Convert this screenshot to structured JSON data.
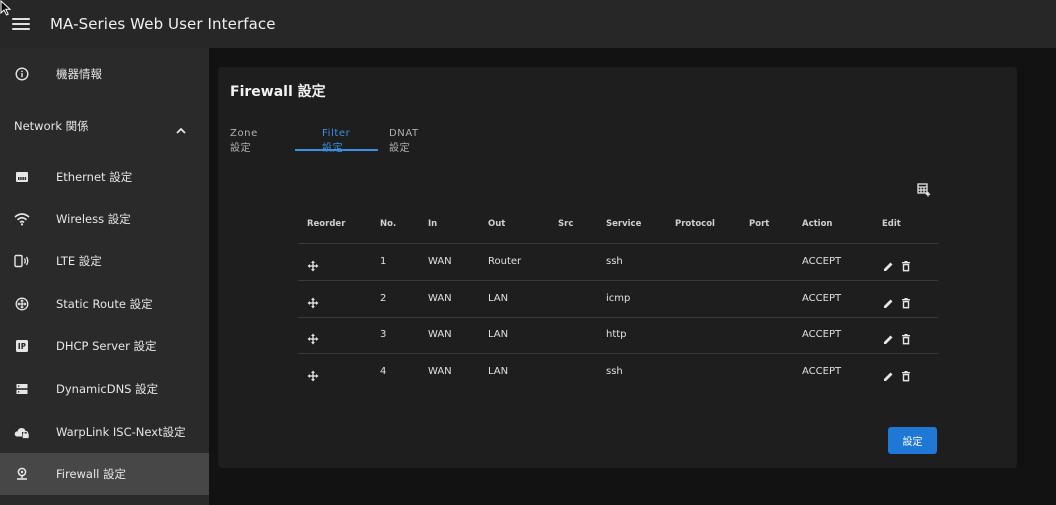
{
  "app": {
    "title": "MA-Series Web User Interface"
  },
  "sidebar": {
    "items": [
      {
        "label": "機器情報",
        "icon": "info-icon"
      },
      {
        "label": "Ethernet 設定",
        "icon": "ethernet-icon"
      },
      {
        "label": "Wireless 設定",
        "icon": "wifi-icon"
      },
      {
        "label": "LTE 設定",
        "icon": "phone-signal-icon"
      },
      {
        "label": "Static Route 設定",
        "icon": "route-icon"
      },
      {
        "label": "DHCP Server 設定",
        "icon": "ip-icon"
      },
      {
        "label": "DynamicDNS 設定",
        "icon": "dns-icon"
      },
      {
        "label": "WarpLink ISC-Next設定",
        "icon": "cloud-lock-icon"
      },
      {
        "label": "Firewall 設定",
        "icon": "firewall-icon"
      }
    ],
    "group_label": "Network 関係",
    "active_item": "Firewall 設定"
  },
  "card": {
    "title": "Firewall 設定",
    "tabs": [
      {
        "label": "Zone 設定"
      },
      {
        "label": "Filter 設定"
      },
      {
        "label": "DNAT 設定"
      }
    ],
    "active_tab": "Filter 設定"
  },
  "table": {
    "headers": [
      "Reorder",
      "No.",
      "In",
      "Out",
      "Src",
      "Service",
      "Protocol",
      "Port",
      "Action",
      "Edit"
    ],
    "rows": [
      {
        "no": "1",
        "in": "WAN",
        "out": "Router",
        "src": "",
        "service": "ssh",
        "protocol": "",
        "port": "",
        "action": "ACCEPT"
      },
      {
        "no": "2",
        "in": "WAN",
        "out": "LAN",
        "src": "",
        "service": "icmp",
        "protocol": "",
        "port": "",
        "action": "ACCEPT"
      },
      {
        "no": "3",
        "in": "WAN",
        "out": "LAN",
        "src": "",
        "service": "http",
        "protocol": "",
        "port": "",
        "action": "ACCEPT"
      },
      {
        "no": "4",
        "in": "WAN",
        "out": "LAN",
        "src": "",
        "service": "ssh",
        "protocol": "",
        "port": "",
        "action": "ACCEPT"
      }
    ]
  },
  "save_button": {
    "label": "設定"
  },
  "colors": {
    "accent": "#1f77d6",
    "tab_active": "#3b8fe0",
    "appbar": "#272727",
    "sidebar": "#2a2a2a",
    "card": "#1e1e1e"
  }
}
